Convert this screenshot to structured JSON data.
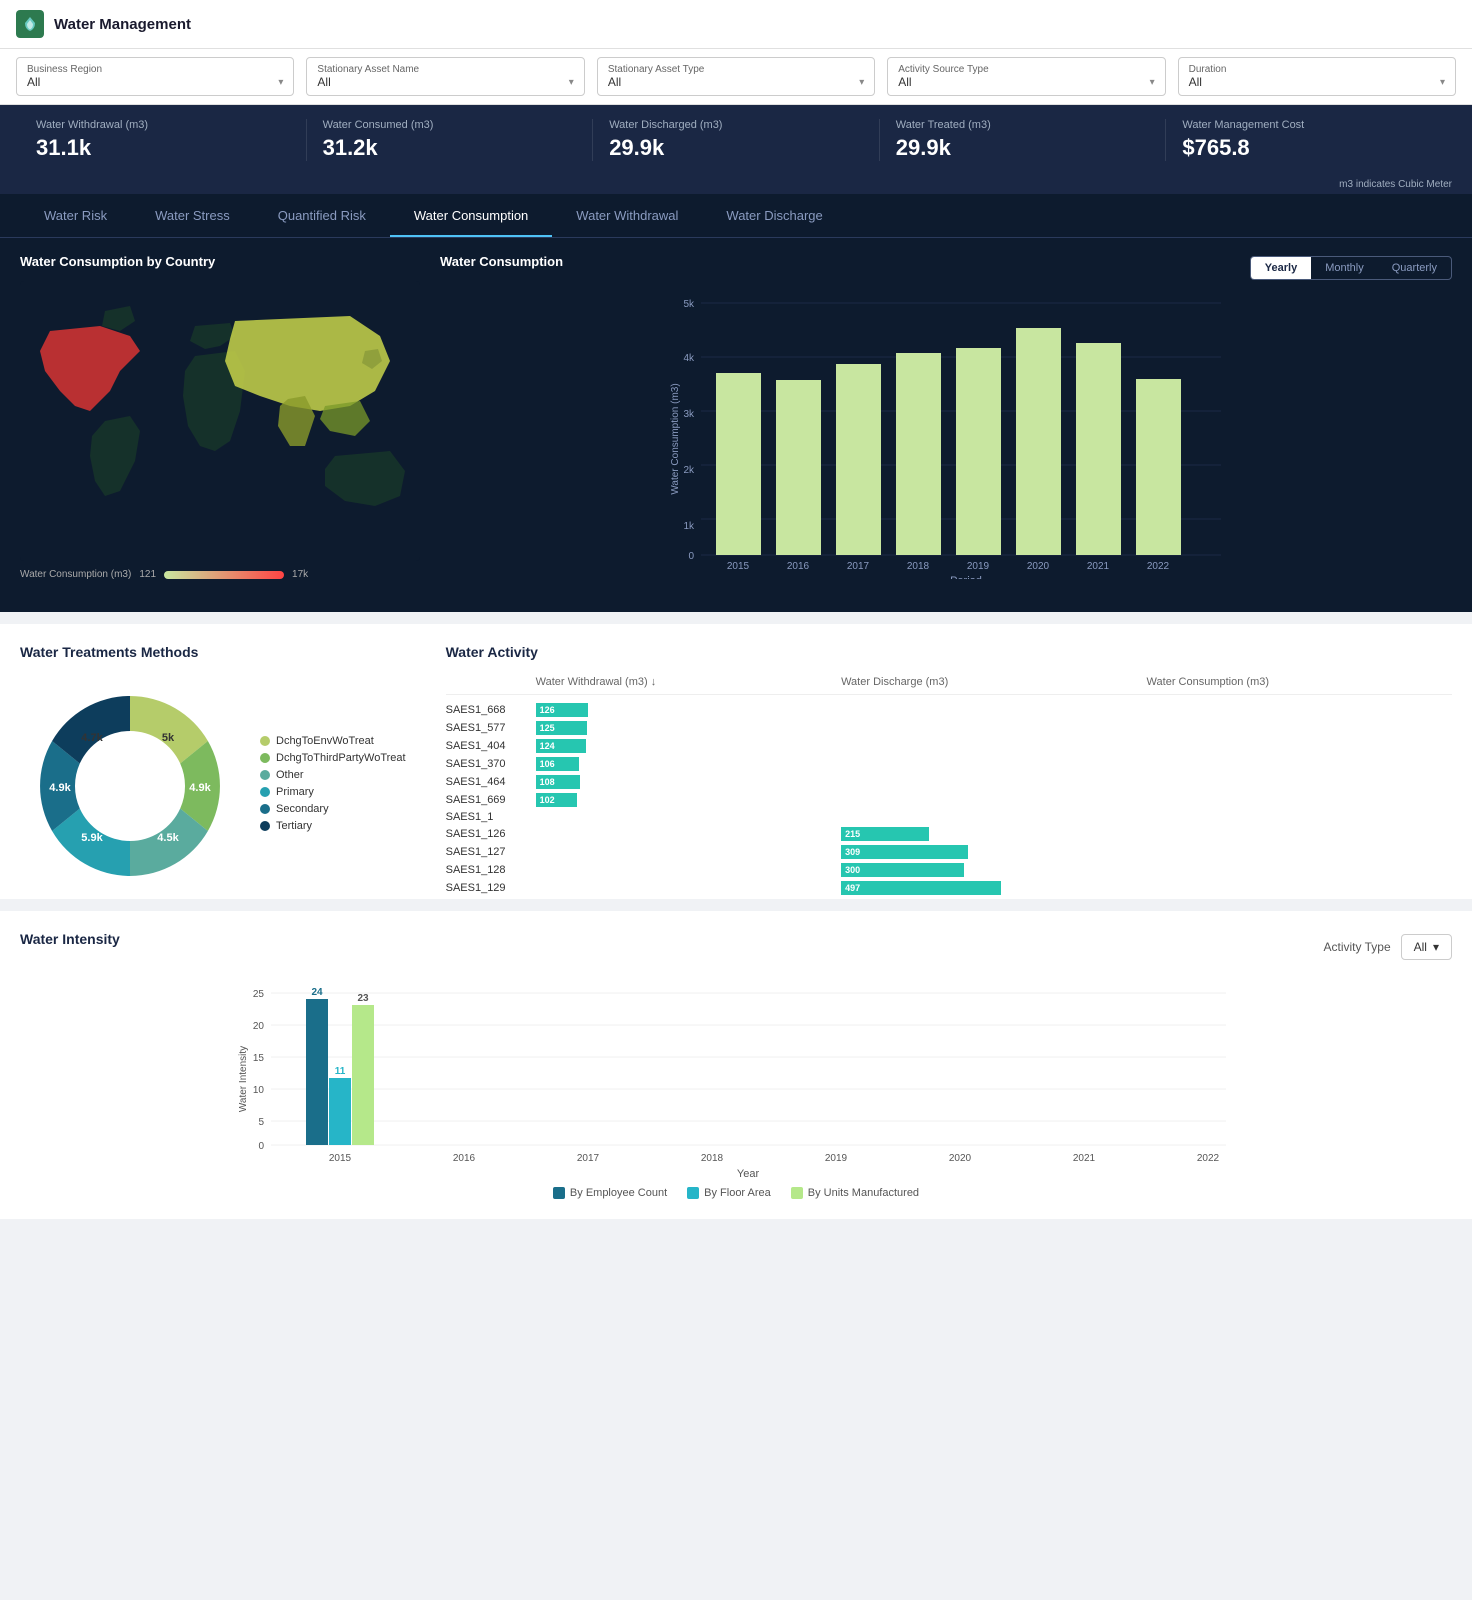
{
  "app": {
    "title": "Water Management"
  },
  "filters": [
    {
      "label": "Business Region",
      "value": "All"
    },
    {
      "label": "Stationary Asset Name",
      "value": "All"
    },
    {
      "label": "Stationary Asset Type",
      "value": "All"
    },
    {
      "label": "Activity Source Type",
      "value": "All"
    },
    {
      "label": "Duration",
      "value": "All"
    }
  ],
  "kpis": [
    {
      "label": "Water Withdrawal (m3)",
      "value": "31.1k"
    },
    {
      "label": "Water Consumed (m3)",
      "value": "31.2k"
    },
    {
      "label": "Water Discharged (m3)",
      "value": "29.9k"
    },
    {
      "label": "Water Treated (m3)",
      "value": "29.9k"
    },
    {
      "label": "Water Management Cost",
      "value": "$765.8"
    }
  ],
  "kpi_note": "m3 indicates Cubic Meter",
  "tabs": [
    {
      "label": "Water Risk",
      "active": false
    },
    {
      "label": "Water Stress",
      "active": false
    },
    {
      "label": "Quantified Risk",
      "active": false
    },
    {
      "label": "Water Consumption",
      "active": true
    },
    {
      "label": "Water Withdrawal",
      "active": false
    },
    {
      "label": "Water Discharge",
      "active": false
    }
  ],
  "waterConsumption": {
    "mapTitle": "Water Consumption by Country",
    "chartTitle": "Water Consumption",
    "viewButtons": [
      "Yearly",
      "Monthly",
      "Quarterly"
    ],
    "activeView": "Yearly",
    "legendMin": "121",
    "legendMax": "17k",
    "legendLabel": "Water Consumption (m3)",
    "barData": [
      {
        "year": "2015",
        "value": 3600
      },
      {
        "year": "2016",
        "value": 3500
      },
      {
        "year": "2017",
        "value": 3800
      },
      {
        "year": "2018",
        "value": 4000
      },
      {
        "year": "2019",
        "value": 4100
      },
      {
        "year": "2020",
        "value": 4500
      },
      {
        "year": "2021",
        "value": 4200
      },
      {
        "year": "2022",
        "value": 3500
      }
    ],
    "yAxisMax": 5000,
    "yAxisLabel": "Water Consumption (m3)"
  },
  "waterTreatments": {
    "title": "Water Treatments Methods",
    "segments": [
      {
        "label": "DchgToEnvWoTreat",
        "color": "#b5cc6a",
        "value": "5k",
        "angle": 60
      },
      {
        "label": "DchgToThirdPartyWoTreat",
        "color": "#7dba5e",
        "value": "4.9k",
        "angle": 60
      },
      {
        "label": "Other",
        "color": "#5aab9e",
        "value": "4.7k",
        "angle": 60
      },
      {
        "label": "Primary",
        "color": "#2196a8",
        "value": "4.5k",
        "angle": 60
      },
      {
        "label": "Secondary",
        "color": "#1a6e8a",
        "value": "5.9k",
        "angle": 60
      },
      {
        "label": "Tertiary",
        "color": "#0d3d5c",
        "value": "4.9k",
        "angle": 60
      }
    ],
    "donutLabels": [
      {
        "label": "5k",
        "top": "18%",
        "left": "62%"
      },
      {
        "label": "4.9k",
        "top": "18%",
        "left": "8%"
      },
      {
        "label": "4.7k",
        "top": "50%",
        "left": "2%"
      },
      {
        "label": "4.5k",
        "top": "70%",
        "left": "55%"
      },
      {
        "label": "5.9k",
        "top": "70%",
        "left": "20%"
      },
      {
        "label": "4.9k",
        "top": "50%",
        "left": "68%"
      }
    ]
  },
  "waterActivity": {
    "title": "Water Activity",
    "columns": [
      "",
      "Water Withdrawal (m3) ↓",
      "Water Discharge (m3)",
      "Water Consumption (m3)"
    ],
    "rows": [
      {
        "name": "SAES1_668",
        "wd": 126,
        "dc": null,
        "wc": null
      },
      {
        "name": "SAES1_577",
        "wd": 125,
        "dc": null,
        "wc": null
      },
      {
        "name": "SAES1_404",
        "wd": 124,
        "dc": null,
        "wc": null
      },
      {
        "name": "SAES1_370",
        "wd": 106,
        "dc": null,
        "wc": null
      },
      {
        "name": "SAES1_464",
        "wd": 108,
        "dc": null,
        "wc": null
      },
      {
        "name": "SAES1_669",
        "wd": 102,
        "dc": null,
        "wc": null
      },
      {
        "name": "SAES1_1",
        "wd": null,
        "dc": null,
        "wc": null
      },
      {
        "name": "SAES1_126",
        "wd": null,
        "dc": 215,
        "wc": null
      },
      {
        "name": "SAES1_127",
        "wd": null,
        "dc": 309,
        "wc": null
      },
      {
        "name": "SAES1_128",
        "wd": null,
        "dc": 300,
        "wc": null
      },
      {
        "name": "SAES1_129",
        "wd": null,
        "dc": 497,
        "wc": null
      }
    ]
  },
  "waterIntensity": {
    "title": "Water Intensity",
    "activityTypeLabel": "Activity Type",
    "activityTypeValue": "All",
    "yAxisLabel": "Water Intensity",
    "xAxisLabel": "Year",
    "years": [
      "2015",
      "2016",
      "2017",
      "2018",
      "2019",
      "2020",
      "2021",
      "2022"
    ],
    "series": [
      {
        "name": "By Employee Count",
        "color": "#1a6e8a",
        "values": [
          24,
          0,
          0,
          0,
          0,
          0,
          0,
          0
        ]
      },
      {
        "name": "By Floor Area",
        "color": "#26b5c8",
        "values": [
          11,
          0,
          0,
          0,
          0,
          0,
          0,
          0
        ]
      },
      {
        "name": "By Units Manufactured",
        "color": "#b5e88a",
        "values": [
          23,
          0,
          0,
          0,
          0,
          0,
          0,
          0
        ]
      }
    ],
    "yMax": 25
  }
}
